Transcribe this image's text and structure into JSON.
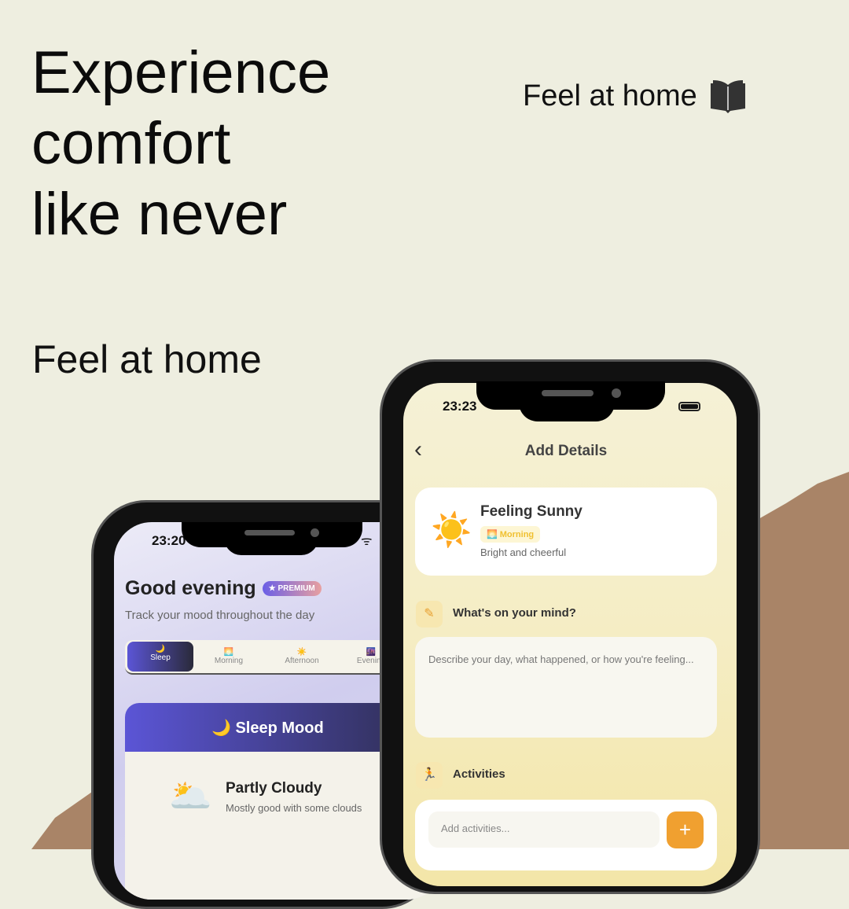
{
  "headline": {
    "line1": "Experience",
    "line2": "comfort",
    "line3": "like never"
  },
  "tagline_top": "Feel at home",
  "tagline_left": "Feel at home",
  "colors": {
    "background": "#eeeee0",
    "paper": "#a98467",
    "accent_orange": "#f0a030",
    "accent_purple": "#5b55d6"
  },
  "left_phone": {
    "time": "23:20",
    "greeting": "Good evening",
    "badge": "PREMIUM",
    "subtitle": "Track your mood throughout the day",
    "tabs": [
      {
        "icon": "🌙",
        "label": "Sleep"
      },
      {
        "icon": "🌅",
        "label": "Morning"
      },
      {
        "icon": "☀️",
        "label": "Afternoon"
      },
      {
        "icon": "🌆",
        "label": "Evening"
      }
    ],
    "mood_header": "🌙 Sleep Mood",
    "mood_icon": "🌥️",
    "mood_title": "Partly Cloudy",
    "mood_desc": "Mostly good with some clouds"
  },
  "right_phone": {
    "time": "23:23",
    "title": "Add Details",
    "back": "‹",
    "mood_icon": "☀️",
    "mood_title": "Feeling Sunny",
    "period_icon": "🌅",
    "period": "Morning",
    "mood_desc": "Bright and cheerful",
    "mind_label": "What's on your mind?",
    "mind_placeholder": "Describe your day, what happened, or how you're feeling...",
    "activities_label": "Activities",
    "activities_placeholder": "Add activities...",
    "add": "+"
  }
}
